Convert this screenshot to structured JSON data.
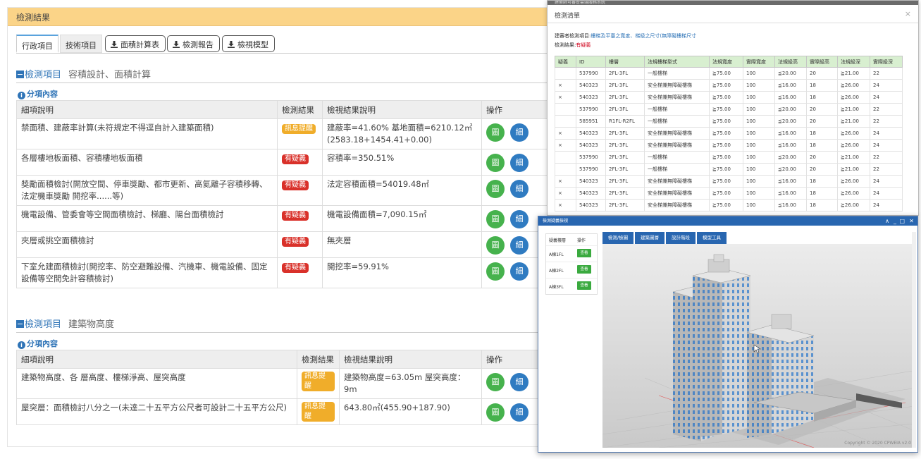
{
  "panel": {
    "title": "檢測結果"
  },
  "tabs": {
    "admin": "行政項目",
    "tech": "技術項目",
    "area_calc": "面積計算表",
    "report": "檢測報告",
    "model": "檢視模型"
  },
  "section1": {
    "key": "檢測項目",
    "name": "容積設計、面積計算",
    "sub": "分項內容",
    "headers": [
      "細項說明",
      "檢測結果",
      "檢視結果說明",
      "操作"
    ],
    "rows": [
      {
        "desc": "禁面積、建蔽率計算(未符規定不得逕自計入建築面積)",
        "result": "訊息提醒",
        "result_type": "warn",
        "note": "建蔽率=41.60% 基地面積=6210.12㎡ (2583.18+1454.41+0.00)"
      },
      {
        "desc": "各層樓地板面積、容積樓地板面積",
        "result": "有疑義",
        "result_type": "danger",
        "note": "容積率=350.51%"
      },
      {
        "desc": "獎勵面積檢討(開放空間、停車獎勵、都市更新、高氦離子容積移轉、法定機車獎勵 開挖率......等)",
        "result": "有疑義",
        "result_type": "danger",
        "note": "法定容積面積=54019.48㎡"
      },
      {
        "desc": "機電設備、管委會等空間面積檢討、梯廳、陽台面積檢討",
        "result": "有疑義",
        "result_type": "danger",
        "note": "機電設備面積=7,090.15㎡"
      },
      {
        "desc": "夾層或挑空面積檢討",
        "result": "有疑義",
        "result_type": "danger",
        "note": "無夾層"
      },
      {
        "desc": "下室允建面積檢討(開挖率、防空避難設備、汽機車、機電設備、固定設備等空間免計容積檢討)",
        "result": "有疑義",
        "result_type": "danger",
        "note": "開挖率=59.91%"
      }
    ]
  },
  "section2": {
    "key": "檢測項目",
    "name": "建築物高度",
    "sub": "分項內容",
    "headers": [
      "細項說明",
      "檢測結果",
      "檢視結果說明",
      "操作"
    ],
    "rows": [
      {
        "desc": "建築物高度、各 層高度、樓梯淨高、屋突高度",
        "result": "訊息提醒",
        "result_type": "warn",
        "note": "建築物高度=63.05m 屋突高度：9m"
      },
      {
        "desc": "屋突層：面積檢討八分之一(未達二十五平方公尺者可設計二十五平方公尺)",
        "result": "訊息提醒",
        "result_type": "warn",
        "note": "643.80㎡(455.90+187.90)"
      }
    ]
  },
  "actions": {
    "view": "圖",
    "detail": "細"
  },
  "list_window": {
    "title": "檢測清單",
    "close": "×",
    "topbar": "建築師可審查雲端服務系統",
    "item_label": "建審者檢測項目:",
    "item_value": "樓梯及平臺之寬度、梯級之尺寸(無障礙樓梯尺寸",
    "result_label": "檢測結果:",
    "result_value": "有疑義",
    "headers": [
      "疑義",
      "ID",
      "樓層",
      "法規樓梯型式",
      "法規寬度",
      "實際寬度",
      "法規級高",
      "實際級高",
      "法規級深",
      "實際級深"
    ],
    "rows": [
      [
        "",
        "537990",
        "2FL-3FL",
        "一般樓梯",
        "≧75.00",
        "100",
        "≦20.00",
        "20",
        "≧21.00",
        "22"
      ],
      [
        "×",
        "540323",
        "2FL-3FL",
        "安全梯兼無障礙樓梯",
        "≧75.00",
        "100",
        "≦16.00",
        "18",
        "≧26.00",
        "24"
      ],
      [
        "×",
        "540323",
        "2FL-3FL",
        "安全梯兼無障礙樓梯",
        "≧75.00",
        "100",
        "≦16.00",
        "18",
        "≧26.00",
        "24"
      ],
      [
        "",
        "537990",
        "2FL-3FL",
        "一般樓梯",
        "≧75.00",
        "100",
        "≦20.00",
        "20",
        "≧21.00",
        "22"
      ],
      [
        "",
        "585951",
        "R1FL-R2FL",
        "一般樓梯",
        "≧75.00",
        "100",
        "≦20.00",
        "20",
        "≧21.00",
        "22"
      ],
      [
        "×",
        "540323",
        "2FL-3FL",
        "安全梯兼無障礙樓梯",
        "≧75.00",
        "100",
        "≦16.00",
        "18",
        "≧26.00",
        "24"
      ],
      [
        "×",
        "540323",
        "2FL-3FL",
        "安全梯兼無障礙樓梯",
        "≧75.00",
        "100",
        "≦16.00",
        "18",
        "≧26.00",
        "24"
      ],
      [
        "",
        "537990",
        "2FL-3FL",
        "一般樓梯",
        "≧75.00",
        "100",
        "≦20.00",
        "20",
        "≧21.00",
        "22"
      ],
      [
        "",
        "537990",
        "2FL-3FL",
        "一般樓梯",
        "≧75.00",
        "100",
        "≦20.00",
        "20",
        "≧21.00",
        "22"
      ],
      [
        "×",
        "540323",
        "2FL-3FL",
        "安全梯兼無障礙樓梯",
        "≧75.00",
        "100",
        "≦16.00",
        "18",
        "≧26.00",
        "24"
      ],
      [
        "×",
        "540323",
        "2FL-3FL",
        "安全梯兼無障礙樓梯",
        "≧75.00",
        "100",
        "≦16.00",
        "18",
        "≧26.00",
        "24"
      ],
      [
        "×",
        "540323",
        "2FL-3FL",
        "安全梯兼無障礙樓梯",
        "≧75.00",
        "100",
        "≦16.00",
        "18",
        "≧26.00",
        "24"
      ]
    ]
  },
  "viewer_window": {
    "title": "檢測疑義檢視",
    "controls": {
      "collapse": "∧",
      "minimize": "_",
      "maximize": "□",
      "close": "✕"
    },
    "floor_headers": [
      "疑義樓層",
      "操作"
    ],
    "floors": [
      {
        "name": "A棟1FL",
        "action": "查看"
      },
      {
        "name": "A棟2FL",
        "action": "查看"
      },
      {
        "name": "A棟3FL",
        "action": "查看"
      }
    ],
    "tabs": [
      "檢測/檢圖",
      "建築圖層",
      "設計階段",
      "模型工具"
    ],
    "copyright": "Copyright © 2020 CPWEIA v2.0"
  },
  "colors": {
    "header_bg": "#fbd488",
    "brand_blue": "#2f74b7",
    "warn": "#f0ad2a",
    "danger": "#d9312a",
    "view_button": "#46b24d",
    "detail_button": "#2f7bc1",
    "viewer_header": "#2866b0"
  }
}
